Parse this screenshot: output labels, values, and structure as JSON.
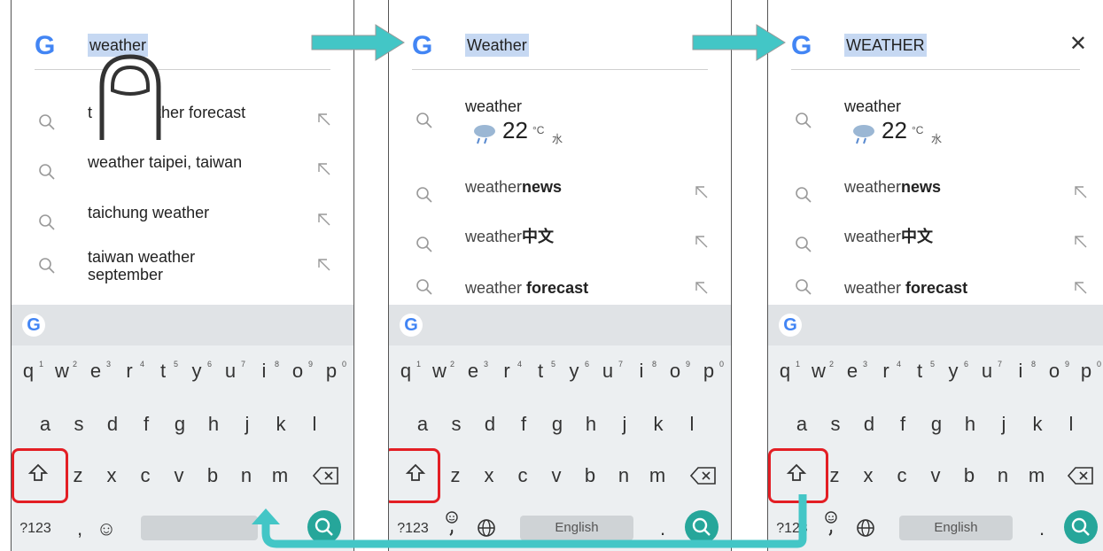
{
  "colors": {
    "accent_teal": "#43c6c6",
    "highlight_red": "#e31e24",
    "search_green": "#26a69a",
    "selection_blue": "#c6d8f2"
  },
  "panel1": {
    "query": "weather",
    "suggestions": [
      {
        "pre": "t",
        "post": "veather forecast"
      },
      {
        "pre": "weather taipei, taiwan",
        "post": ""
      },
      {
        "pre": "taichung weather",
        "post": ""
      },
      {
        "pre": "taiwan weather",
        "post": "september"
      }
    ],
    "keyboard": {
      "bottom_left": "?123",
      "comma": ",",
      "emoji": "☺"
    }
  },
  "panel2": {
    "query": "Weather",
    "weather": {
      "title": "weather",
      "temp": "22",
      "unit": "°C",
      "day": "水"
    },
    "suggestions": [
      {
        "pre": "weather",
        "bold": "news"
      },
      {
        "pre": "weather",
        "bold": "中文"
      },
      {
        "pre": "weather ",
        "bold": "forecast"
      }
    ],
    "keyboard": {
      "bottom_left": "?123",
      "space_label": "English",
      "period": "."
    }
  },
  "panel3": {
    "query": "WEATHER",
    "weather": {
      "title": "weather",
      "temp": "22",
      "unit": "°C",
      "day": "水"
    },
    "suggestions": [
      {
        "pre": "weather",
        "bold": "news"
      },
      {
        "pre": "weather",
        "bold": "中文"
      },
      {
        "pre": "weather ",
        "bold": "forecast"
      }
    ],
    "keyboard": {
      "bottom_left": "?123",
      "space_label": "English",
      "period": "."
    }
  },
  "keys": {
    "row1": [
      "q",
      "w",
      "e",
      "r",
      "t",
      "y",
      "u",
      "i",
      "o",
      "p"
    ],
    "row1_hints": [
      "1",
      "2",
      "3",
      "4",
      "5",
      "6",
      "7",
      "8",
      "9",
      "0"
    ],
    "row2": [
      "a",
      "s",
      "d",
      "f",
      "g",
      "h",
      "j",
      "k",
      "l"
    ],
    "row3": [
      "z",
      "x",
      "c",
      "v",
      "b",
      "n",
      "m"
    ]
  }
}
